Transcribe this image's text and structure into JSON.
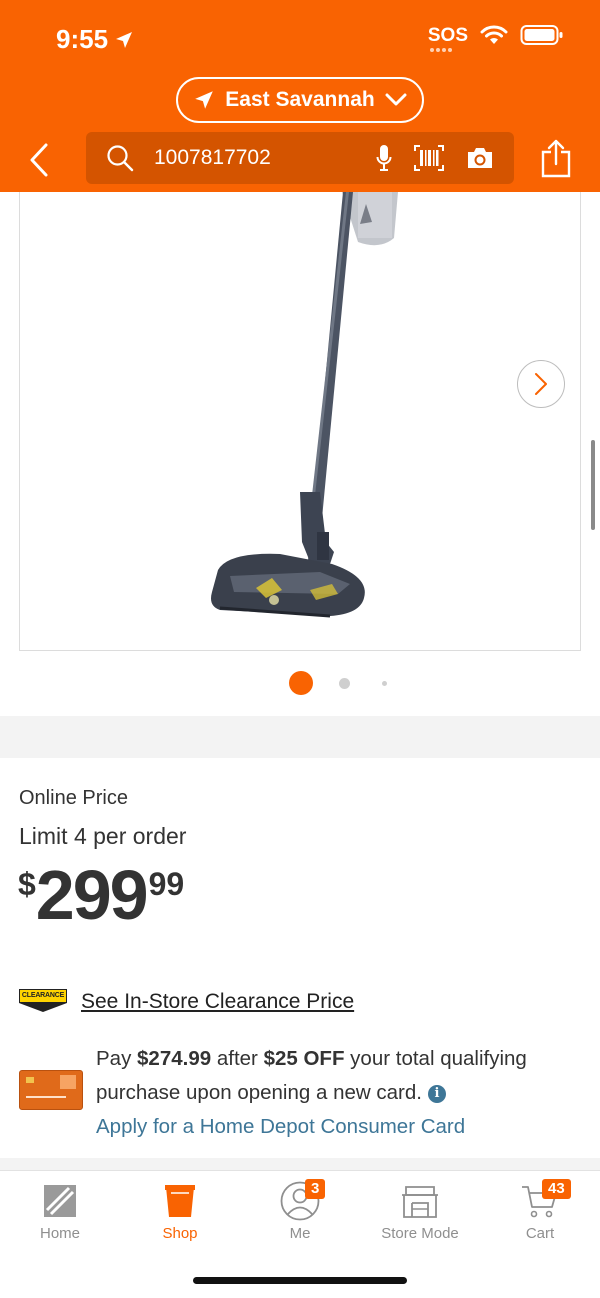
{
  "status_bar": {
    "time": "9:55",
    "sos": "SOS"
  },
  "header": {
    "location": "East Savannah",
    "search_value": "1007817702"
  },
  "product": {
    "carousel_dots": 3,
    "active_dot": 1
  },
  "pricing": {
    "online_label": "Online Price",
    "limit": "Limit 4 per order",
    "currency": "$",
    "dollars": "299",
    "cents": "99",
    "clearance_badge": "CLEARANCE",
    "clearance_link": "See In-Store Clearance Price"
  },
  "card_offer": {
    "pay_prefix": "Pay",
    "discounted_price": "$274.99",
    "after": "after",
    "discount": "$25 OFF",
    "rest": "your total qualifying purchase upon opening a new card.",
    "info": "i",
    "apply_link": "Apply for a Home Depot Consumer Card"
  },
  "tabbar": {
    "items": [
      {
        "label": "Home",
        "icon": "home-depot-logo-icon",
        "active": false
      },
      {
        "label": "Shop",
        "icon": "bucket-icon",
        "active": true
      },
      {
        "label": "Me",
        "icon": "user-icon",
        "active": false,
        "badge": "3"
      },
      {
        "label": "Store Mode",
        "icon": "store-icon",
        "active": false
      },
      {
        "label": "Cart",
        "icon": "cart-icon",
        "active": false,
        "badge": "43"
      }
    ]
  },
  "colors": {
    "brand_orange": "#f96302",
    "search_bg": "#d45400",
    "link_blue": "#3e7697",
    "clearance_yellow": "#ffd400"
  }
}
